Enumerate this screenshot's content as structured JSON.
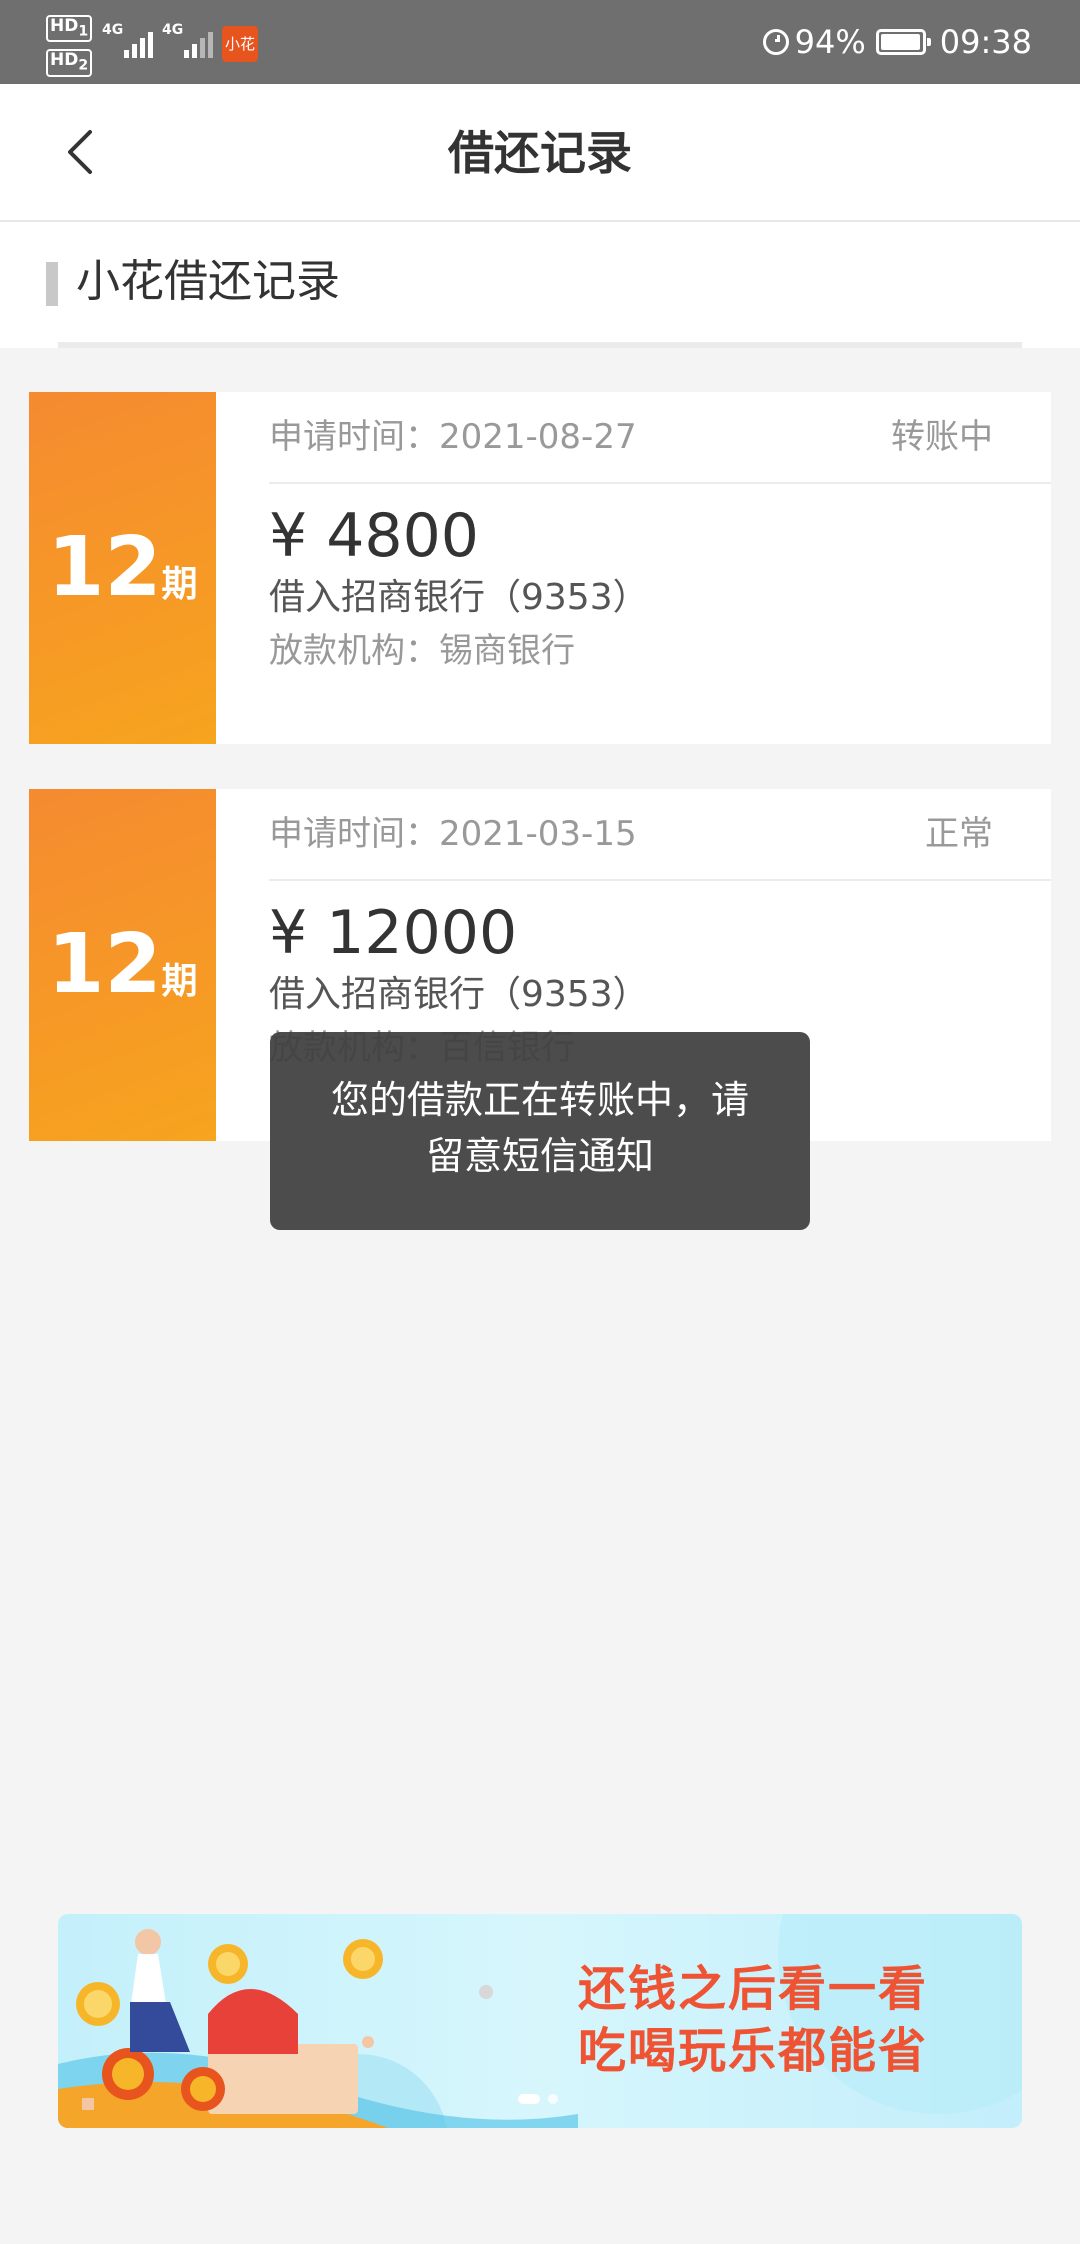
{
  "status_bar": {
    "hd1": "HD",
    "hd1_sub": "1",
    "hd2": "HD",
    "hd2_sub": "2",
    "network1": "4G",
    "network2": "4G",
    "app_badge": "小花",
    "battery": "94%",
    "time": "09:38",
    "icons": [
      "hd-icon",
      "signal-icon",
      "signal-icon",
      "app-notification-icon",
      "alarm-icon",
      "battery-icon"
    ]
  },
  "header": {
    "title": "借还记录",
    "back_icon": "chevron-left-icon"
  },
  "section": {
    "title": "小花借还记录"
  },
  "records": [
    {
      "term_number": "12",
      "term_unit": "期",
      "date": "申请时间：2021-08-27",
      "status": "转账中",
      "amount": "¥ 4800",
      "bank": "借入招商银行（9353）",
      "lender": "放款机构：锡商银行"
    },
    {
      "term_number": "12",
      "term_unit": "期",
      "date": "申请时间：2021-03-15",
      "status": "正常",
      "amount": "¥ 12000",
      "bank": "借入招商银行（9353）",
      "lender": "放款机构：百信银行"
    }
  ],
  "toast": {
    "message": "您的借款正在转账中，请留意短信通知"
  },
  "banner": {
    "line1": "还钱之后看一看",
    "line2": "吃喝玩乐都能省",
    "slide_count": 2,
    "active_slide": 1
  },
  "colors": {
    "accent_orange": "#f58a30",
    "banner_text": "#ee5433",
    "status_bar": "#6f6f6f",
    "background": "#f4f4f4"
  }
}
